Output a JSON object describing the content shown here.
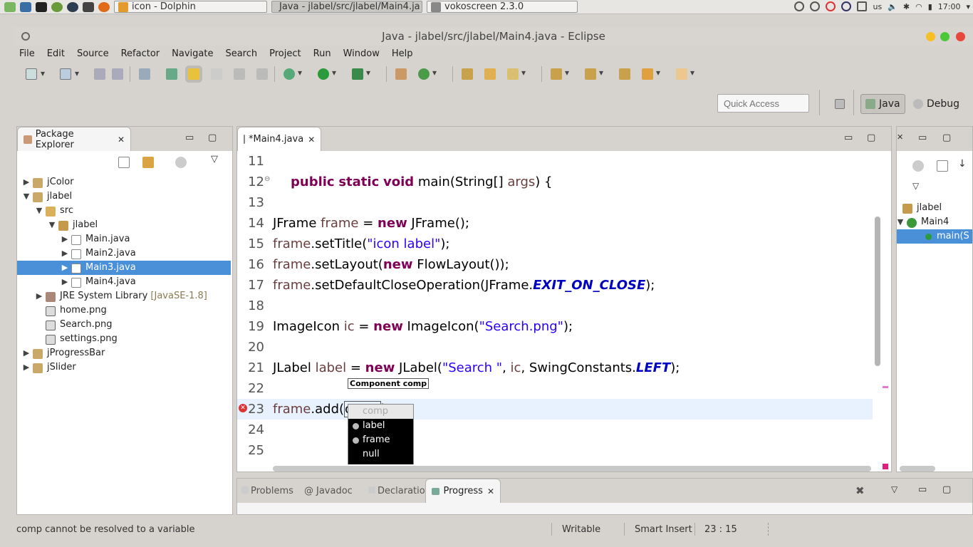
{
  "taskbar": {
    "tasks": [
      {
        "label": "icon - Dolphin"
      },
      {
        "label": "Java - jlabel/src/jlabel/Main4.ja"
      },
      {
        "label": "vokoscreen 2.3.0"
      }
    ],
    "layout": "us",
    "time": "17:00"
  },
  "window": {
    "title": "Java - jlabel/src/jlabel/Main4.java - Eclipse"
  },
  "menu": [
    "File",
    "Edit",
    "Source",
    "Refactor",
    "Navigate",
    "Search",
    "Project",
    "Run",
    "Window",
    "Help"
  ],
  "quick_access": {
    "placeholder": "Quick Access"
  },
  "perspectives": {
    "java": "Java",
    "debug": "Debug"
  },
  "package_explorer": {
    "title": "Package Explorer",
    "tree": [
      {
        "label": "jColor"
      },
      {
        "label": "jlabel"
      },
      {
        "label": "src"
      },
      {
        "label": "jlabel"
      },
      {
        "label": "Main.java"
      },
      {
        "label": "Main2.java"
      },
      {
        "label": "Main3.java",
        "selected": true
      },
      {
        "label": "Main4.java"
      },
      {
        "label": "JRE System Library",
        "suffix": "[JavaSE-1.8]"
      },
      {
        "label": "home.png"
      },
      {
        "label": "Search.png"
      },
      {
        "label": "settings.png"
      },
      {
        "label": "jProgressBar"
      },
      {
        "label": "jSlider"
      }
    ]
  },
  "editor": {
    "tab": "*Main4.java",
    "lines": [
      {
        "n": "11",
        "code": ""
      },
      {
        "n": "12",
        "code": "public static void main(String[] args) {"
      },
      {
        "n": "13",
        "code": ""
      },
      {
        "n": "14",
        "code": "JFrame frame = new JFrame();"
      },
      {
        "n": "15",
        "code": "frame.setTitle(\"icon label\");"
      },
      {
        "n": "16",
        "code": "frame.setLayout(new FlowLayout());"
      },
      {
        "n": "17",
        "code": "frame.setDefaultCloseOperation(JFrame.EXIT_ON_CLOSE);"
      },
      {
        "n": "18",
        "code": ""
      },
      {
        "n": "19",
        "code": "ImageIcon ic = new ImageIcon(\"Search.png\");"
      },
      {
        "n": "20",
        "code": ""
      },
      {
        "n": "21",
        "code": "JLabel label = new JLabel(\"Search \", ic, SwingConstants.LEFT);"
      },
      {
        "n": "22",
        "code": ""
      },
      {
        "n": "23",
        "code": "frame.add(comp)"
      },
      {
        "n": "24",
        "code": ""
      },
      {
        "n": "25",
        "code": ""
      }
    ],
    "param_hint": "Component comp",
    "completions": [
      "comp",
      "label",
      "frame",
      "null"
    ]
  },
  "outline": {
    "items": [
      "jlabel",
      "Main4",
      "main(S"
    ]
  },
  "bottom_tabs": [
    "Problems",
    "Javadoc",
    "Declaration",
    "Progress"
  ],
  "status": {
    "message": "comp cannot be resolved to a variable",
    "writable": "Writable",
    "insert_mode": "Smart Insert",
    "position": "23 : 15"
  },
  "colors": {
    "keyword": "#7f0055",
    "string": "#2a00ff",
    "selection": "#4a90d9",
    "current_line": "#e8f2fe"
  }
}
